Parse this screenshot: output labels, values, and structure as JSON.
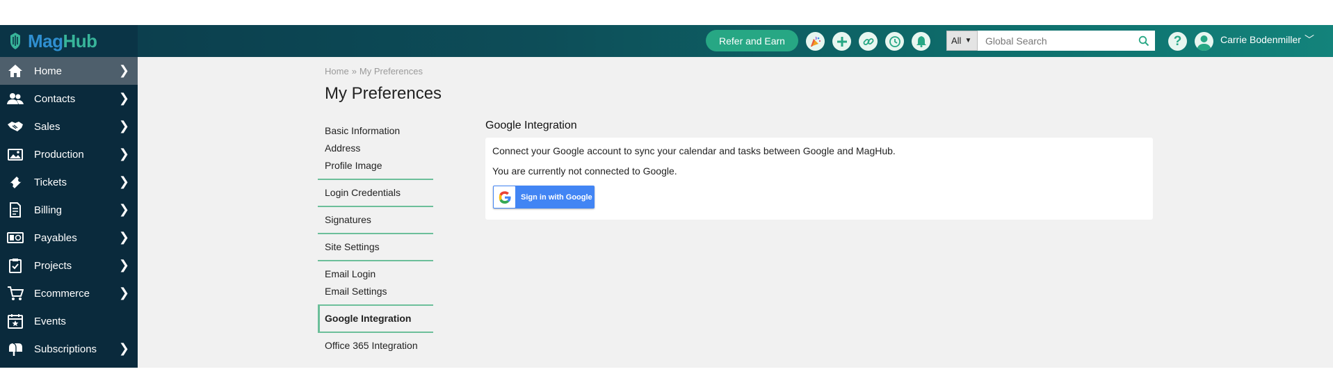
{
  "header": {
    "logo": {
      "part1": "Mag",
      "part2": "Hub"
    },
    "refer_label": "Refer and Earn",
    "search": {
      "scope": "All",
      "placeholder": "Global Search"
    },
    "help_label": "?",
    "user_name": "Carrie Bodenmiller"
  },
  "sidebar": {
    "items": [
      {
        "label": "Home",
        "icon": "home-icon",
        "active": true,
        "chevron": "❯"
      },
      {
        "label": "Contacts",
        "icon": "contacts-icon",
        "chevron": "❯"
      },
      {
        "label": "Sales",
        "icon": "handshake-icon",
        "chevron": "❯"
      },
      {
        "label": "Production",
        "icon": "image-icon",
        "chevron": "❯"
      },
      {
        "label": "Tickets",
        "icon": "ticket-icon",
        "chevron": "❯"
      },
      {
        "label": "Billing",
        "icon": "invoice-icon",
        "chevron": "❯"
      },
      {
        "label": "Payables",
        "icon": "money-icon",
        "chevron": "❯"
      },
      {
        "label": "Projects",
        "icon": "clipboard-check-icon",
        "chevron": "❯"
      },
      {
        "label": "Ecommerce",
        "icon": "cart-icon",
        "chevron": "❯"
      },
      {
        "label": "Events",
        "icon": "calendar-star-icon",
        "chevron": ""
      },
      {
        "label": "Subscriptions",
        "icon": "mailbox-icon",
        "chevron": "❯"
      }
    ]
  },
  "breadcrumb": {
    "home": "Home",
    "separator": "»",
    "current": "My Preferences"
  },
  "page_title": "My Preferences",
  "subnav": {
    "groups": [
      {
        "items": [
          "Basic Information",
          "Address",
          "Profile Image"
        ]
      },
      {
        "items": [
          "Login Credentials"
        ]
      },
      {
        "items": [
          "Signatures"
        ]
      },
      {
        "items": [
          "Site Settings"
        ]
      },
      {
        "items": [
          "Email Login",
          "Email Settings"
        ]
      },
      {
        "items": [
          "Google Integration"
        ],
        "active": true
      },
      {
        "items": [
          "Office 365 Integration"
        ]
      }
    ]
  },
  "google": {
    "section_title": "Google Integration",
    "description": "Connect your Google account to sync your calendar and tasks between Google and MagHub.",
    "status": "You are currently not connected to Google.",
    "button_label": "Sign in with Google"
  },
  "colors": {
    "accent": "#27a784",
    "sidebar_bg": "#0a2a3c",
    "sidebar_active": "#4e5f6c",
    "google_blue": "#4285f4"
  }
}
